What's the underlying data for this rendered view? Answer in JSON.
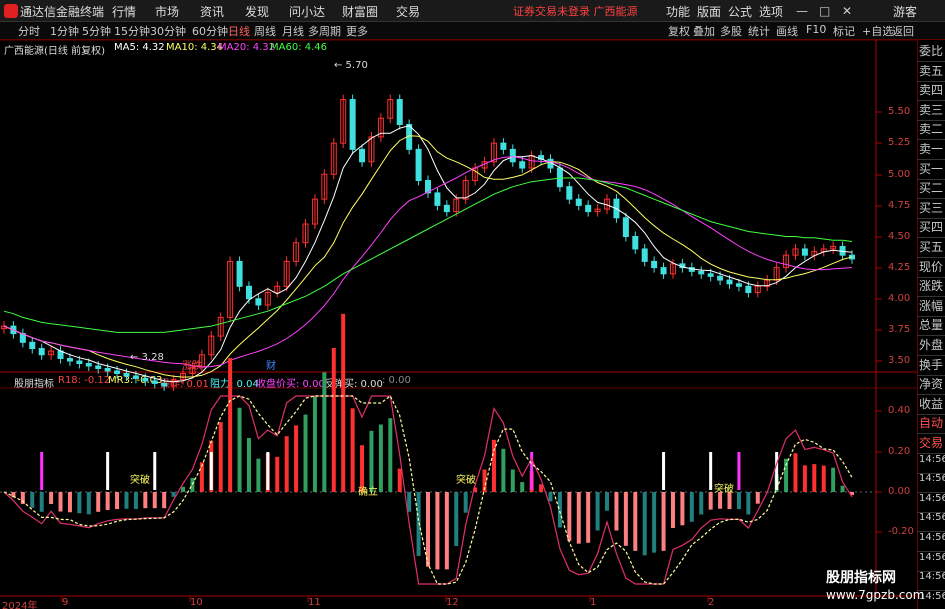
{
  "app": {
    "title": "通达信金融终端",
    "promo": "证券交易未登录  广西能源"
  },
  "menu": [
    "行情",
    "市场",
    "资讯",
    "发现",
    "问小达",
    "财富圈",
    "交易"
  ],
  "right_menu": [
    "功能",
    "版面",
    "公式",
    "选项"
  ],
  "guest": "游客",
  "periods": [
    "分时",
    "1分钟",
    "5分钟",
    "15分钟",
    "30分钟",
    "60分钟",
    "日线",
    "周线",
    "月线",
    "多周期",
    "更多"
  ],
  "active_period": "日线",
  "toolbar_right": [
    "复权",
    "叠加",
    "多股",
    "统计",
    "画线",
    "F10",
    "标记",
    "+自选",
    "返回"
  ],
  "main_legend": {
    "name": "广西能源(日线 前复权)",
    "ma5": "MA5: 4.32",
    "ma10": "MA10: 4.34",
    "ma20": "MA20: 4.32",
    "ma60": "MA60: 4.46"
  },
  "indicator_legend": {
    "name": "股朋指标",
    "r18": "R18: -0.12",
    "mr3": "MR3: -0.03",
    "op": "操作: 0.01",
    "res": "阻力: 0.04",
    "buy": "收盘价买: 0.00",
    "rebound": "反弹买: 0.00",
    "extra": ": 0.00"
  },
  "price_axis": [
    "5.50",
    "5.25",
    "5.00",
    "4.75",
    "4.50",
    "4.25",
    "4.00",
    "3.75",
    "3.50"
  ],
  "ind_axis": [
    "0.40",
    "0.20",
    "0.00",
    "-0.20"
  ],
  "annotations": {
    "high": "5.70",
    "low": "3.28",
    "tag1": "涨跌",
    "tag2": "财",
    "sig1": "突破",
    "sig2": "确立",
    "sig3": "突破",
    "sig4": "突破"
  },
  "sidebar": [
    "委比",
    "卖五",
    "卖四",
    "卖三",
    "卖二",
    "卖一",
    "买一",
    "买二",
    "买三",
    "买四",
    "买五",
    "现价",
    "涨跌",
    "涨幅",
    "总量",
    "外盘",
    "换手",
    "净资",
    "收益",
    "自动",
    "交易",
    "14:56",
    "14:56",
    "14:56",
    "14:56",
    "14:56",
    "14:56",
    "14:56",
    "14:56"
  ],
  "x_axis": [
    "2024年",
    "9",
    "10",
    "11",
    "12",
    "1",
    "2"
  ],
  "watermark": {
    "title": "股朋指标网",
    "url": "www.7gpzb.com"
  },
  "colors": {
    "up": "#ff3030",
    "down": "#40e0e0",
    "ma5": "#ffffff",
    "ma10": "#ffff60",
    "ma20": "#ff40ff",
    "ma60": "#40ff40",
    "grid": "#7a0000"
  },
  "chart_data": {
    "type": "candlestick",
    "title": "广西能源(日线 前复权)",
    "ylim": [
      3.2,
      5.8
    ],
    "close": [
      3.78,
      3.72,
      3.65,
      3.6,
      3.55,
      3.58,
      3.52,
      3.5,
      3.48,
      3.46,
      3.44,
      3.42,
      3.4,
      3.38,
      3.36,
      3.34,
      3.32,
      3.3,
      3.35,
      3.4,
      3.45,
      3.55,
      3.7,
      3.85,
      4.3,
      4.1,
      4.0,
      3.95,
      4.05,
      4.1,
      4.3,
      4.45,
      4.6,
      4.8,
      5.0,
      5.25,
      5.6,
      5.2,
      5.1,
      5.3,
      5.45,
      5.6,
      5.4,
      5.2,
      4.95,
      4.85,
      4.75,
      4.7,
      4.8,
      4.95,
      5.05,
      5.1,
      5.25,
      5.2,
      5.1,
      5.05,
      5.15,
      5.12,
      5.05,
      4.9,
      4.8,
      4.75,
      4.7,
      4.72,
      4.8,
      4.65,
      4.5,
      4.4,
      4.3,
      4.25,
      4.2,
      4.28,
      4.25,
      4.22,
      4.2,
      4.18,
      4.15,
      4.12,
      4.1,
      4.05,
      4.1,
      4.15,
      4.25,
      4.35,
      4.4,
      4.35,
      4.38,
      4.4,
      4.42,
      4.35,
      4.32
    ],
    "ma60": [
      3.9,
      3.88,
      3.85,
      3.83,
      3.81,
      3.8,
      3.79,
      3.78,
      3.77,
      3.76,
      3.75,
      3.74,
      3.73,
      3.73,
      3.73,
      3.73,
      3.73,
      3.73,
      3.74,
      3.75,
      3.76,
      3.77,
      3.78,
      3.8,
      3.82,
      3.84,
      3.86,
      3.88,
      3.9,
      3.93,
      3.96,
      3.99,
      4.02,
      4.06,
      4.1,
      4.15,
      4.2,
      4.24,
      4.28,
      4.32,
      4.36,
      4.4,
      4.44,
      4.48,
      4.52,
      4.56,
      4.6,
      4.64,
      4.68,
      4.72,
      4.76,
      4.8,
      4.84,
      4.87,
      4.9,
      4.92,
      4.94,
      4.95,
      4.96,
      4.97,
      4.97,
      4.97,
      4.96,
      4.95,
      4.93,
      4.91,
      4.89,
      4.86,
      4.83,
      4.8,
      4.77,
      4.74,
      4.71,
      4.68,
      4.65,
      4.62,
      4.6,
      4.58,
      4.56,
      4.54,
      4.53,
      4.52,
      4.51,
      4.5,
      4.5,
      4.49,
      4.49,
      4.48,
      4.47,
      4.47,
      4.46
    ]
  }
}
